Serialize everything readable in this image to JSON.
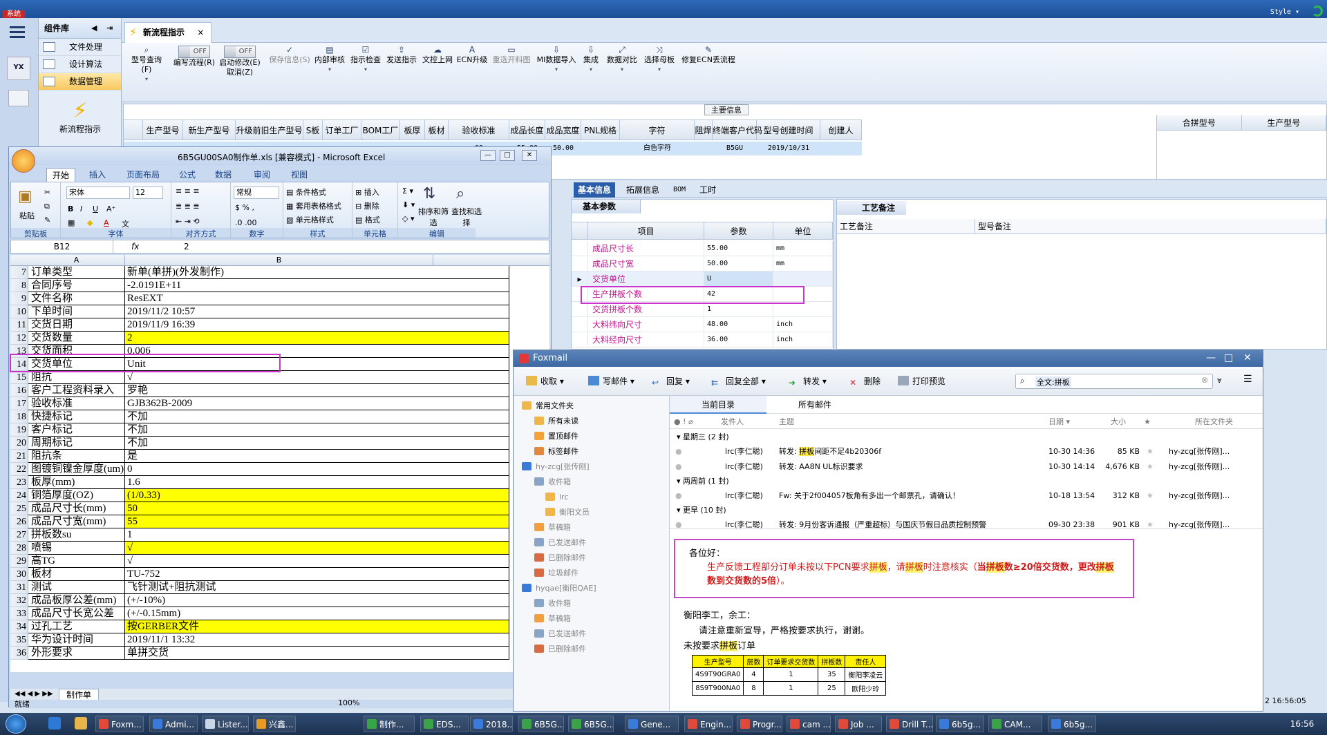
{
  "app": {
    "system_label": "系统",
    "style_label": "Style",
    "rail_logo": "YX"
  },
  "complib": {
    "title": "组件库",
    "items": [
      "文件处理",
      "设计算法",
      "数据管理"
    ],
    "new_flow": "新流程指示"
  },
  "tab": {
    "label": "新流程指示",
    "close": "×"
  },
  "toolbar": {
    "items": [
      {
        "label": "型号查询(F)",
        "icon": "search-icon"
      },
      {
        "label": "编写流程(R)",
        "toggle": "OFF"
      },
      {
        "label": "启动修改(E)",
        "sub": "取消(Z)",
        "toggle": "OFF"
      },
      {
        "label": "保存信息(S)",
        "disabled": true
      },
      {
        "label": "内部审核"
      },
      {
        "label": "指示检查"
      },
      {
        "label": "发送指示"
      },
      {
        "label": "文控上网"
      },
      {
        "label": "ECN升级"
      },
      {
        "label": "重选开料图",
        "disabled": true
      },
      {
        "label": "MI数据导入"
      },
      {
        "label": "集成"
      },
      {
        "label": "数据对比"
      },
      {
        "label": "选择母板"
      },
      {
        "label": "修复ECN丢流程"
      }
    ]
  },
  "main_info": {
    "caption": "主要信息",
    "columns": [
      "生产型号",
      "新生产型号",
      "升级前旧生产型号",
      "S板",
      "订单工厂",
      "BOM工厂",
      "板厚",
      "板材",
      "验收标准",
      "成品长度",
      "成品宽度",
      "PNL规格",
      "字符",
      "阻焊",
      "终端客户代码",
      "型号创建时间",
      "创建人"
    ],
    "row": [
      "",
      "",
      "",
      "",
      "",
      "",
      "",
      "",
      "09",
      "55.00",
      "50.00",
      "",
      "白色字符",
      "",
      "B5GU",
      "2019/10/31",
      ""
    ],
    "right_columns": [
      "合拼型号",
      "生产型号"
    ]
  },
  "lower_tabs": [
    "基本信息",
    "拓展信息",
    "BOM",
    "工时"
  ],
  "basic_params": {
    "caption": "基本参数",
    "columns": [
      "项目",
      "参数",
      "单位"
    ],
    "rows": [
      {
        "k": "成品尺寸长",
        "v": "55.00",
        "u": "mm"
      },
      {
        "k": "成品尺寸宽",
        "v": "50.00",
        "u": "mm"
      },
      {
        "k": "交货单位",
        "v": "U",
        "u": ""
      },
      {
        "k": "生产拼板个数",
        "v": "42",
        "u": ""
      },
      {
        "k": "交货拼板个数",
        "v": "1",
        "u": ""
      },
      {
        "k": "大料纬向尺寸",
        "v": "48.00",
        "u": "inch"
      },
      {
        "k": "大料经向尺寸",
        "v": "36.00",
        "u": "inch"
      }
    ]
  },
  "craft_note": {
    "caption": "工艺备注",
    "col1": "工艺备注",
    "col2": "型号备注"
  },
  "excel": {
    "title": "6B5GU00SA0制作单.xls [兼容模式] - Microsoft Excel",
    "tabs": [
      "开始",
      "插入",
      "页面布局",
      "公式",
      "数据",
      "审阅",
      "视图"
    ],
    "ribbon": {
      "paste": "粘贴",
      "font_name": "宋体",
      "font_size": "12",
      "number_format": "常规",
      "cond_format": "条件格式",
      "table_format": "套用表格格式",
      "cell_style": "单元格样式",
      "insert": "插入",
      "delete": "删除",
      "format": "格式",
      "sort": "排序和筛选",
      "find": "查找和选择",
      "groups": [
        "剪贴板",
        "字体",
        "对齐方式",
        "数字",
        "样式",
        "单元格",
        "编辑"
      ]
    },
    "name_box": "B12",
    "fx": "fx",
    "formula": "2",
    "col_a": "A",
    "col_b": "B",
    "rows": [
      {
        "n": "7",
        "a": "订单类型",
        "b": "新单(单拼)(外发制作)",
        "y": false
      },
      {
        "n": "8",
        "a": "合同序号",
        "b": "-2.0191E+11",
        "y": false
      },
      {
        "n": "9",
        "a": "文件名称",
        "b": "ResEXT",
        "y": false
      },
      {
        "n": "10",
        "a": "下单时间",
        "b": "2019/11/2 10:57",
        "y": false
      },
      {
        "n": "11",
        "a": "交货日期",
        "b": "2019/11/9 16:39",
        "y": false
      },
      {
        "n": "12",
        "a": "交货数量",
        "b": "2",
        "y": true
      },
      {
        "n": "13",
        "a": "交货面积",
        "b": "0.006",
        "y": false
      },
      {
        "n": "14",
        "a": "交货单位",
        "b": "Unit",
        "y": false
      },
      {
        "n": "15",
        "a": "阻抗",
        "b": "√",
        "y": false
      },
      {
        "n": "16",
        "a": "客户工程资料录入",
        "b": "罗艳",
        "y": false
      },
      {
        "n": "17",
        "a": "验收标准",
        "b": "GJB362B-2009",
        "y": false
      },
      {
        "n": "18",
        "a": "快捷标记",
        "b": "不加",
        "y": false
      },
      {
        "n": "19",
        "a": "客户标记",
        "b": "不加",
        "y": false
      },
      {
        "n": "20",
        "a": "周期标记",
        "b": "不加",
        "y": false
      },
      {
        "n": "21",
        "a": "阻抗条",
        "b": "是",
        "y": false
      },
      {
        "n": "22",
        "a": "图镀铜镍金厚度(um)",
        "b": "0",
        "y": false
      },
      {
        "n": "23",
        "a": "板厚(mm)",
        "b": "1.6",
        "y": false
      },
      {
        "n": "24",
        "a": "铜箔厚度(OZ)",
        "b": "(1/0.33)",
        "y": true
      },
      {
        "n": "25",
        "a": "成品尺寸长(mm)",
        "b": "50",
        "y": true
      },
      {
        "n": "26",
        "a": "成品尺寸宽(mm)",
        "b": "55",
        "y": true
      },
      {
        "n": "27",
        "a": "拼板数su",
        "b": "1",
        "y": false
      },
      {
        "n": "28",
        "a": "喷锡",
        "b": "√",
        "y": true
      },
      {
        "n": "29",
        "a": "高TG",
        "b": "√",
        "y": false
      },
      {
        "n": "30",
        "a": "板材",
        "b": "TU-752",
        "y": false
      },
      {
        "n": "31",
        "a": "测试",
        "b": "飞针测试+阻抗测试",
        "y": false
      },
      {
        "n": "32",
        "a": "成品板厚公差(mm)",
        "b": "(+/-10%)",
        "y": false
      },
      {
        "n": "33",
        "a": "成品尺寸长宽公差",
        "b": "(+/-0.15mm)",
        "y": false
      },
      {
        "n": "34",
        "a": "过孔工艺",
        "b": "按GERBER文件",
        "y": true
      },
      {
        "n": "35",
        "a": "华为设计时间",
        "b": "2019/11/1 13:32",
        "y": false
      },
      {
        "n": "36",
        "a": "外形要求",
        "b": "单拼交货",
        "y": false
      }
    ],
    "sheet_tab": "制作单",
    "status": "就绪",
    "zoom": "100%"
  },
  "foxmail": {
    "title": "Foxmail",
    "toolbar": [
      "收取",
      "写邮件",
      "回复",
      "回复全部",
      "转发",
      "删除",
      "打印预览"
    ],
    "search": "全文:拼板",
    "sidebar": [
      {
        "label": "常用文件夹",
        "c": "#f0b64a",
        "x": 12,
        "gray": false
      },
      {
        "label": "所有未读",
        "c": "#f0b64a",
        "x": 30,
        "gray": false
      },
      {
        "label": "置顶邮件",
        "c": "#f4a236",
        "x": 30,
        "gray": false
      },
      {
        "label": "标签邮件",
        "c": "#e2873d",
        "x": 30,
        "gray": false
      },
      {
        "label": "hy-zcg[张传刚]",
        "c": "#3a7ad8",
        "x": 12,
        "gray": true
      },
      {
        "label": "收件箱",
        "c": "#8aa4c8",
        "x": 30,
        "gray": true
      },
      {
        "label": "lrc",
        "c": "#f0b64a",
        "x": 46,
        "gray": true
      },
      {
        "label": "衡阳文员",
        "c": "#f0b64a",
        "x": 46,
        "gray": true
      },
      {
        "label": "草稿箱",
        "c": "#f0a040",
        "x": 30,
        "gray": true
      },
      {
        "label": "已发送邮件",
        "c": "#8aa4c8",
        "x": 30,
        "gray": true
      },
      {
        "label": "已删除邮件",
        "c": "#d86a44",
        "x": 30,
        "gray": true
      },
      {
        "label": "垃圾邮件",
        "c": "#d86a44",
        "x": 30,
        "gray": true
      },
      {
        "label": "hyqae[衡阳QAE]",
        "c": "#3a7ad8",
        "x": 12,
        "gray": true
      },
      {
        "label": "收件箱",
        "c": "#8aa4c8",
        "x": 30,
        "gray": true
      },
      {
        "label": "草稿箱",
        "c": "#f0a040",
        "x": 30,
        "gray": true
      },
      {
        "label": "已发送邮件",
        "c": "#8aa4c8",
        "x": 30,
        "gray": true
      },
      {
        "label": "已删除邮件",
        "c": "#d86a44",
        "x": 30,
        "gray": true
      }
    ],
    "list_tabs": [
      "当前目录",
      "所有邮件"
    ],
    "list_header": {
      "from": "发件人",
      "subject": "主题",
      "date": "日期",
      "size": "大小",
      "folder": "所在文件夹"
    },
    "groups": [
      "星期三 (2 封)",
      "两周前 (1 封)",
      "更早 (10 封)"
    ],
    "mails": [
      {
        "from": "lrc(李仁聪)",
        "pre": "转发:",
        "hl": "拼板",
        "subject": "间距不足4b20306f",
        "date": "10-30 14:36",
        "size": "85 KB",
        "folder": "hy-zcg[张传刚]..."
      },
      {
        "from": "lrc(李仁聪)",
        "pre": "转发:",
        "hl": "",
        "subject": "AA8N  UL标识要求",
        "date": "10-30 14:14",
        "size": "4,676 KB",
        "folder": "hy-zcg[张传刚]..."
      },
      {
        "from": "lrc(李仁聪)",
        "pre": "Fw:",
        "hl": "",
        "subject": "关于2f004057板角有多出一个邮票孔，请确认！",
        "date": "10-18 13:54",
        "size": "312 KB",
        "folder": "hy-zcg[张传刚]..."
      },
      {
        "from": "lrc(李仁聪)",
        "pre": "转发:",
        "hl": "",
        "subject": "9月份客诉通报（严重超标）与国庆节假日品质控制预警",
        "date": "09-30 23:38",
        "size": "901 KB",
        "folder": "hy-zcg[张传刚]..."
      }
    ],
    "preview": {
      "greet": "各位好：",
      "line1a": "生产反馈工程部分订单未按以下PCN要求",
      "hl1": "拼板",
      "line1b": "，请",
      "hl2": "拼板",
      "line1c": "时注意核实（",
      "bold1": "当",
      "hl3": "拼板",
      "bold2": "数≥20倍交货数，更改",
      "hl4": "拼板",
      "bold3": "数到交货数的5倍",
      "line1d": "）。",
      "to": "衡阳李工，余工：",
      "ask": "请注意重新宣导，严格按要求执行，谢谢。",
      "sub_a": "未按要求",
      "sub_hl": "拼板",
      "sub_b": "订单",
      "table_headers": [
        "生产型号",
        "层数",
        "订单要求交货数",
        "拼板数",
        "责任人"
      ],
      "table_rows": [
        [
          "4S9T90GRA0",
          "4",
          "1",
          "35",
          "衡阳李凌云"
        ],
        [
          "8S9T900NA0",
          "8",
          "1",
          "25",
          "欧阳少玲"
        ]
      ]
    }
  },
  "edge_time": "2 16:56:05",
  "taskbar": {
    "items": [
      "Foxm...",
      "Admi...",
      "Lister...",
      "兴鑫...",
      "制作...",
      "EDS...",
      "2018...",
      "6B5G...",
      "6B5G...",
      "Gene...",
      "Engin...",
      "Progr...",
      "cam ...",
      "Job ...",
      "Drill T...",
      "6b5g...",
      "CAM...",
      "6b5g..."
    ],
    "clock": "16:56"
  }
}
